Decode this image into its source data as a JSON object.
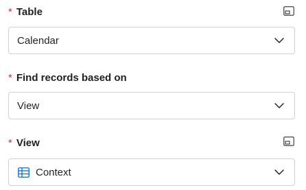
{
  "fields": [
    {
      "label": "Table",
      "required_mark": "*",
      "value": "Calendar",
      "has_expand_icon": true,
      "icon": "chevron-down-icon"
    },
    {
      "label": "Find records based on",
      "required_mark": "*",
      "value": "View",
      "has_expand_icon": false,
      "icon": "chevron-down-icon"
    },
    {
      "label": "View",
      "required_mark": "*",
      "value": "Context",
      "value_icon": "table-grid-icon",
      "has_expand_icon": true,
      "icon": "chevron-down-icon"
    }
  ],
  "colors": {
    "required": "#c4314b",
    "border": "#d1d1d1",
    "text": "#242424",
    "accent_icon": "#0f6cbd"
  }
}
